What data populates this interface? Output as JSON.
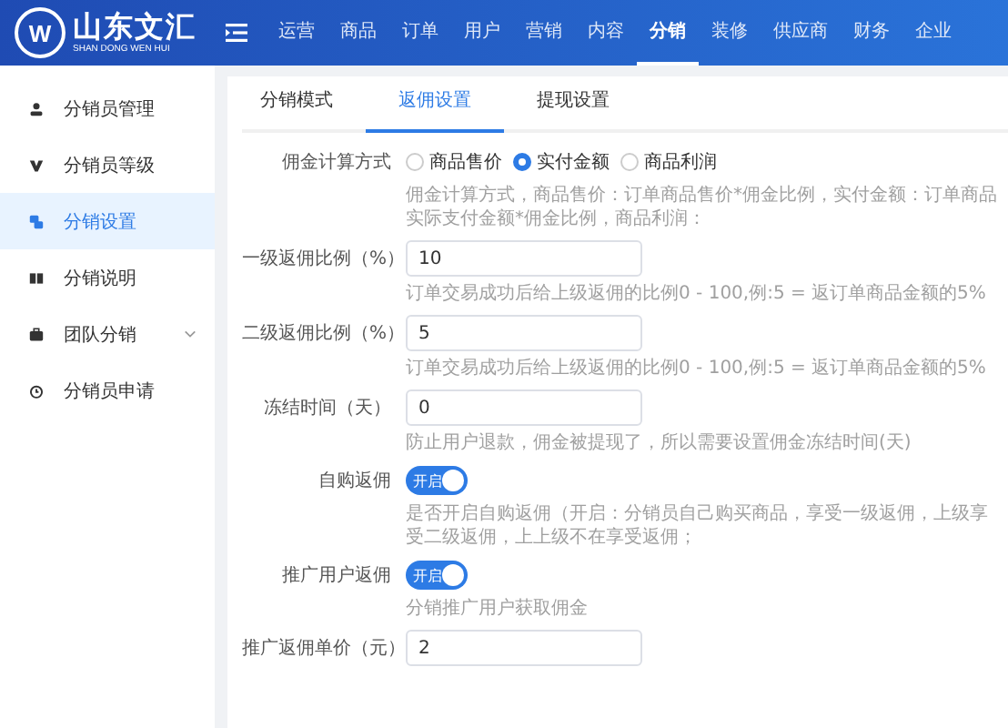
{
  "header": {
    "logo": {
      "mark": "W",
      "name": "山东文汇",
      "subtitle": "SHAN DONG WEN HUI"
    },
    "nav": [
      {
        "label": "运营",
        "selected": false
      },
      {
        "label": "商品",
        "selected": false
      },
      {
        "label": "订单",
        "selected": false
      },
      {
        "label": "用户",
        "selected": false
      },
      {
        "label": "营销",
        "selected": false
      },
      {
        "label": "内容",
        "selected": false
      },
      {
        "label": "分销",
        "selected": true
      },
      {
        "label": "装修",
        "selected": false
      },
      {
        "label": "供应商",
        "selected": false
      },
      {
        "label": "财务",
        "selected": false
      },
      {
        "label": "企业",
        "selected": false
      }
    ]
  },
  "sidebar": {
    "items": [
      {
        "label": "分销员管理",
        "selected": false,
        "has_submenu": false
      },
      {
        "label": "分销员等级",
        "selected": false,
        "has_submenu": false
      },
      {
        "label": "分销设置",
        "selected": true,
        "has_submenu": false
      },
      {
        "label": "分销说明",
        "selected": false,
        "has_submenu": false
      },
      {
        "label": "团队分销",
        "selected": false,
        "has_submenu": true
      },
      {
        "label": "分销员申请",
        "selected": false,
        "has_submenu": false
      }
    ]
  },
  "tabs": [
    {
      "label": "分销模式",
      "selected": false
    },
    {
      "label": "返佣设置",
      "selected": true
    },
    {
      "label": "提现设置",
      "selected": false
    }
  ],
  "form": {
    "fields": [
      {
        "kind": "radio",
        "label": "佣金计算方式",
        "options": [
          {
            "label": "商品售价",
            "selected": false
          },
          {
            "label": "实付金额",
            "selected": true
          },
          {
            "label": "商品利润",
            "selected": false
          }
        ],
        "help": "佣金计算方式，商品售价：订单商品售价*佣金比例，实付金额：订单商品实际支付金额*佣金比例，商品利润："
      },
      {
        "kind": "input",
        "label": "一级返佣比例（%）",
        "value": "10",
        "help": "订单交易成功后给上级返佣的比例0 - 100,例:5 = 返订单商品金额的5%"
      },
      {
        "kind": "input",
        "label": "二级返佣比例（%）",
        "value": "5",
        "help": "订单交易成功后给上级返佣的比例0 - 100,例:5 = 返订单商品金额的5%"
      },
      {
        "kind": "input",
        "label": "冻结时间（天）",
        "value": "0",
        "help": "防止用户退款，佣金被提现了，所以需要设置佣金冻结时间(天)"
      },
      {
        "kind": "switch",
        "label": "自购返佣",
        "on": true,
        "switch_text": "开启",
        "help": "是否开启自购返佣（开启：分销员自己购买商品，享受一级返佣，上级享受二级返佣，上上级不在享受返佣；"
      },
      {
        "kind": "switch",
        "label": "推广用户返佣",
        "on": true,
        "switch_text": "开启",
        "help": "分销推广用户获取佣金"
      },
      {
        "kind": "input",
        "label": "推广返佣单价（元）",
        "value": "2"
      }
    ]
  }
}
